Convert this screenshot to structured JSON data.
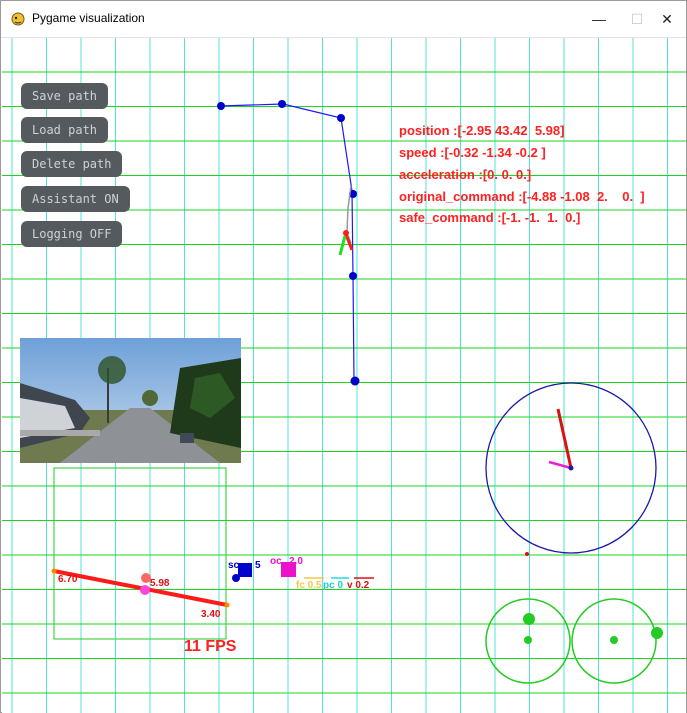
{
  "window": {
    "title": "Pygame visualization",
    "controls": {
      "minimize": "—",
      "maximize": "☐",
      "close": "✕"
    }
  },
  "buttons": {
    "save": "Save path",
    "load": "Load path",
    "delete": "Delete path",
    "assistant": "Assistant ON",
    "logging": "Logging OFF"
  },
  "info": {
    "position": "position :[-2.95 43.42  5.98]",
    "speed": "speed :[-0.32 -1.34 -0.2 ]",
    "acceleration": "acceleration :[0. 0. 0.]",
    "original_command": "original_command :[-4.88 -1.08  2.    0.  ]",
    "safe_command": "safe_command :[-1. -1.  1.  0.]"
  },
  "slider": {
    "left_value": "6.70",
    "mid_value": "5.98",
    "right_value": "3.40"
  },
  "indicators": {
    "sc_label": "sc",
    "sc_value": "5",
    "oc_label": "oc",
    "oc_value": "2.0",
    "fc_label": "fc 0.5",
    "pc_label": "pc 0",
    "v_label": "v 0.2"
  },
  "fps": "11 FPS",
  "colors": {
    "grid_h": "#1ed41e",
    "grid_v": "#4fe4d4",
    "button_bg": "#555a5f",
    "info_text": "#ff2020",
    "path": "#0000cc"
  }
}
